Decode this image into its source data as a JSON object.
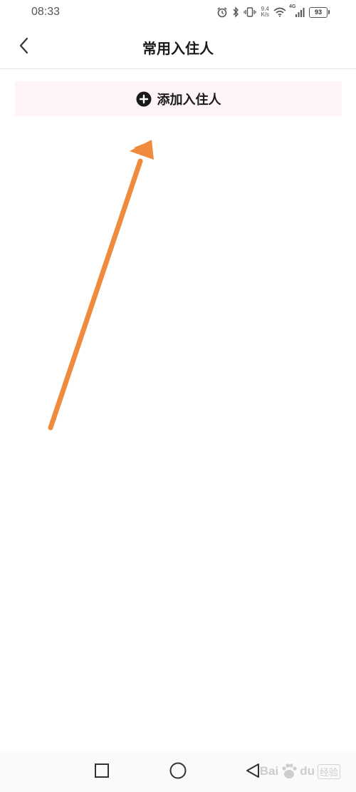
{
  "status_bar": {
    "time": "08:33",
    "net_speed_value": "9.4",
    "net_speed_unit": "K/s",
    "network_type": "4G",
    "battery": "93",
    "icons": [
      "alarm-icon",
      "bluetooth-icon",
      "vibrate-icon",
      "wifi-icon",
      "signal-icon",
      "battery-icon"
    ]
  },
  "header": {
    "title": "常用入住人",
    "back_icon": "chevron-left-icon"
  },
  "main": {
    "add_guest_label": "添加入住人",
    "add_icon": "plus-circle-icon"
  },
  "annotation": {
    "type": "arrow",
    "color": "#f08a3c"
  },
  "nav_bar": {
    "icons": [
      "recent-apps-icon",
      "home-icon",
      "back-icon"
    ]
  },
  "watermark": {
    "text": "Bai",
    "text2": "du",
    "text3": "经验"
  }
}
